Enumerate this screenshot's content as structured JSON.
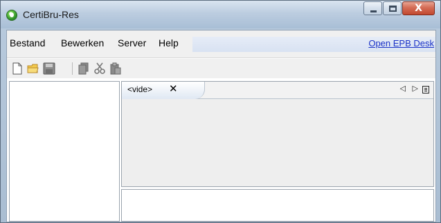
{
  "window": {
    "title": "CertiBru-Res",
    "close_glyph": "X"
  },
  "menubar": {
    "items": [
      "Bestand",
      "Bewerken",
      "Server",
      "Help"
    ],
    "link": "Open EPB Desk"
  },
  "toolbar": {
    "icons": [
      "new-file-icon",
      "open-folder-icon",
      "save-icon",
      "copy-icon",
      "cut-icon",
      "paste-icon"
    ]
  },
  "editor": {
    "tab_label": "<vide>",
    "tab_close_glyph": "✕",
    "nav_prev_glyph": "◁",
    "nav_next_glyph": "▷"
  }
}
